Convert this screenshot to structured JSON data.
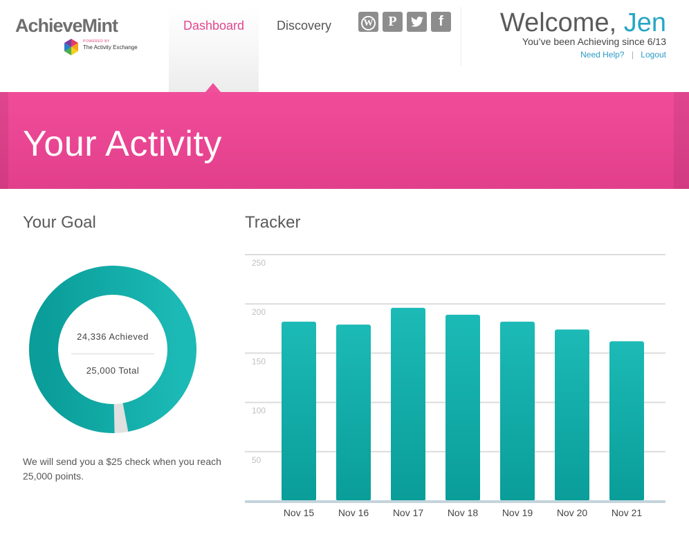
{
  "brand": {
    "name": "AchieveMint",
    "powered_by": "POWERED BY",
    "partner": "The Activity Exchange"
  },
  "nav": {
    "items": [
      {
        "label": "Dashboard",
        "active": true
      },
      {
        "label": "Discovery",
        "active": false
      }
    ]
  },
  "social": [
    {
      "icon": "wordpress-icon",
      "glyph": "W"
    },
    {
      "icon": "pinterest-icon",
      "glyph": "P"
    },
    {
      "icon": "twitter-icon",
      "glyph": "t"
    },
    {
      "icon": "facebook-icon",
      "glyph": "f"
    }
  ],
  "user": {
    "welcome": "Welcome,",
    "name": "Jen",
    "since": "You’ve been Achieving since 6/13",
    "help_link": "Need Help?",
    "separator": "|",
    "logout_link": "Logout"
  },
  "banner": {
    "title": "Your Activity"
  },
  "goal": {
    "title": "Your Goal",
    "achieved_label": "24,336 Achieved",
    "total_label": "25,000 Total",
    "achieved": 24336,
    "total": 25000,
    "note": "We will send you a $25 check when you reach 25,000 points."
  },
  "tracker": {
    "title": "Tracker"
  },
  "colors": {
    "accent_pink": "#ef4f9b",
    "teal": "#17b3b0",
    "teal_dark": "#0a9d99",
    "link_blue": "#2b9bc4"
  },
  "chart_data": {
    "type": "bar",
    "categories": [
      "Nov 15",
      "Nov 16",
      "Nov 17",
      "Nov 18",
      "Nov 19",
      "Nov 20",
      "Nov 21"
    ],
    "values": [
      182,
      179,
      196,
      189,
      182,
      174,
      162
    ],
    "yticks": [
      50,
      100,
      150,
      200,
      250
    ],
    "ylim": [
      0,
      250
    ],
    "grid": true,
    "title": "",
    "xlabel": "",
    "ylabel": ""
  }
}
